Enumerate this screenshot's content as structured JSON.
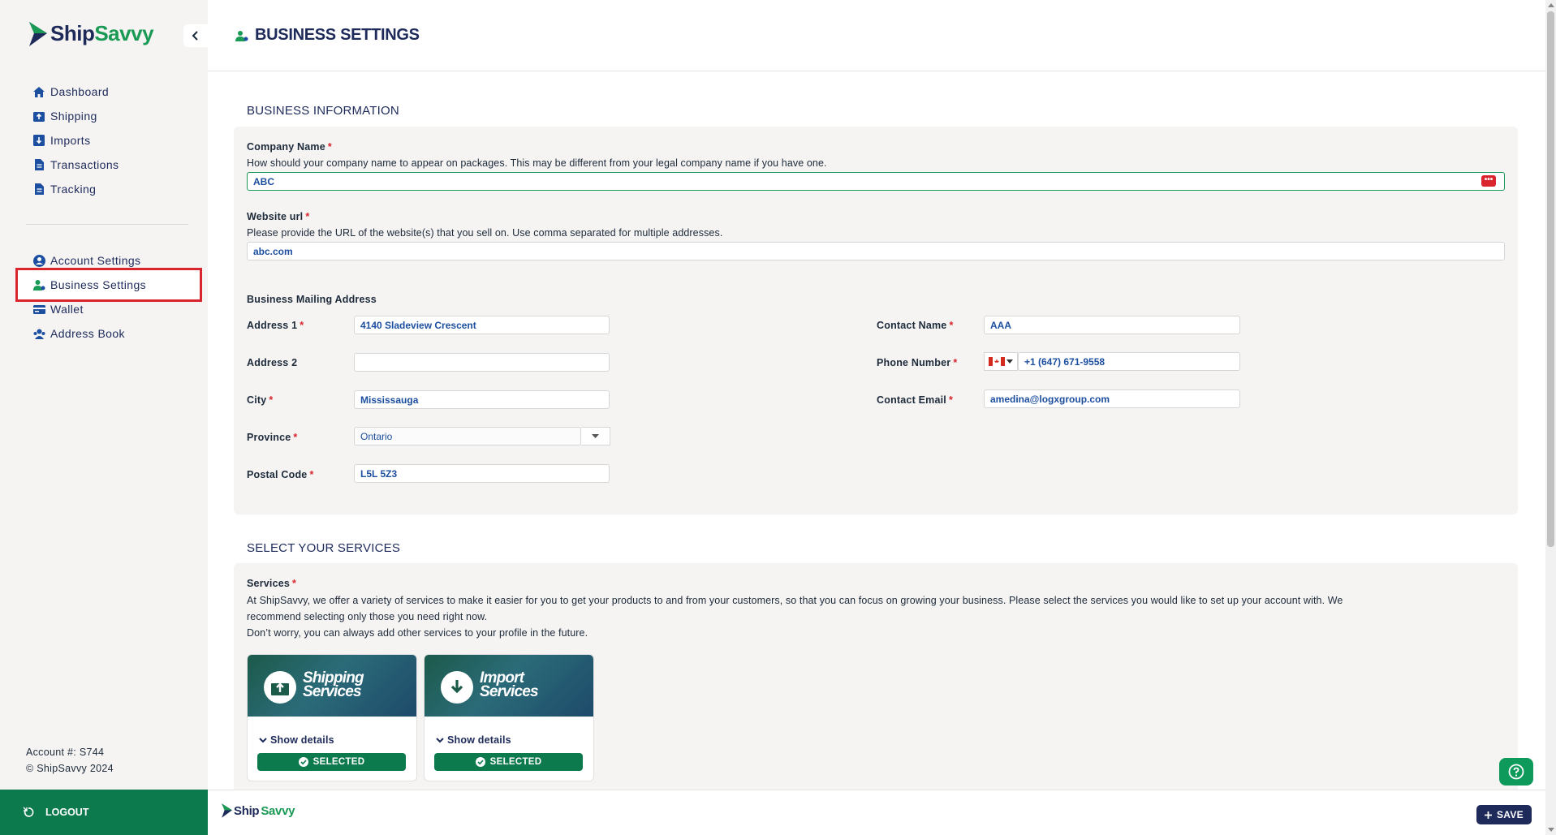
{
  "app": {
    "logo_ship": "Ship",
    "logo_savvy": "Savvy"
  },
  "sidebar": {
    "items": [
      {
        "label": "Dashboard"
      },
      {
        "label": "Shipping"
      },
      {
        "label": "Imports"
      },
      {
        "label": "Transactions"
      },
      {
        "label": "Tracking"
      }
    ],
    "settings_items": [
      {
        "label": "Account Settings"
      },
      {
        "label": "Business Settings"
      },
      {
        "label": "Wallet"
      },
      {
        "label": "Address Book"
      }
    ],
    "account_number": "Account #: S744",
    "copyright": "© ShipSavvy 2024",
    "logout_label": "LOGOUT"
  },
  "header": {
    "title": "BUSINESS SETTINGS"
  },
  "business_info": {
    "section_title": "BUSINESS INFORMATION",
    "company_name": {
      "label": "Company Name",
      "required": "*",
      "help": "How should your company name to appear on packages. This may be different from your legal company name if you have one.",
      "value": "ABC"
    },
    "website": {
      "label": "Website url",
      "required": "*",
      "help": "Please provide the URL of the website(s) that you sell on. Use comma separated for multiple addresses.",
      "value": "abc.com"
    },
    "mailing_address_label": "Business Mailing Address",
    "address1": {
      "label": "Address 1",
      "required": "*",
      "value": "4140 Sladeview Crescent"
    },
    "address2": {
      "label": "Address 2",
      "value": ""
    },
    "city": {
      "label": "City",
      "required": "*",
      "value": "Mississauga"
    },
    "province": {
      "label": "Province",
      "required": "*",
      "value": "Ontario"
    },
    "postal_code": {
      "label": "Postal Code",
      "required": "*",
      "value": "L5L 5Z3"
    },
    "contact_name": {
      "label": "Contact Name",
      "required": "*",
      "value": "AAA"
    },
    "phone": {
      "label": "Phone Number",
      "required": "*",
      "value": "+1 (647) 671-9558"
    },
    "contact_email": {
      "label": "Contact Email",
      "required": "*",
      "value": "amedina@logxgroup.com"
    }
  },
  "services": {
    "section_title": "SELECT YOUR SERVICES",
    "label": "Services",
    "required": "*",
    "description_line1": "At ShipSavvy, we offer a variety of services to make it easier for you to get your products to and from your customers, so that you can focus on growing your business. Please select the services you would like to set up your account with. We",
    "description_line2": "recommend selecting only those you need right now.",
    "description_line3": "Don’t worry, you can always add other services to your profile in the future.",
    "cards": [
      {
        "title_line1": "Shipping",
        "title_line2": "Services",
        "show_details": "Show details",
        "status": "SELECTED"
      },
      {
        "title_line1": "Import",
        "title_line2": "Services",
        "show_details": "Show details",
        "status": "SELECTED"
      }
    ]
  },
  "footer": {
    "logo_ship": "Ship",
    "logo_savvy": "Savvy",
    "save_label": "SAVE"
  },
  "colors": {
    "brand_navy": "#1d2a5a",
    "brand_green": "#1a9a55",
    "accent_dark_green": "#0d7a4e",
    "highlight_red": "#d9252e"
  }
}
